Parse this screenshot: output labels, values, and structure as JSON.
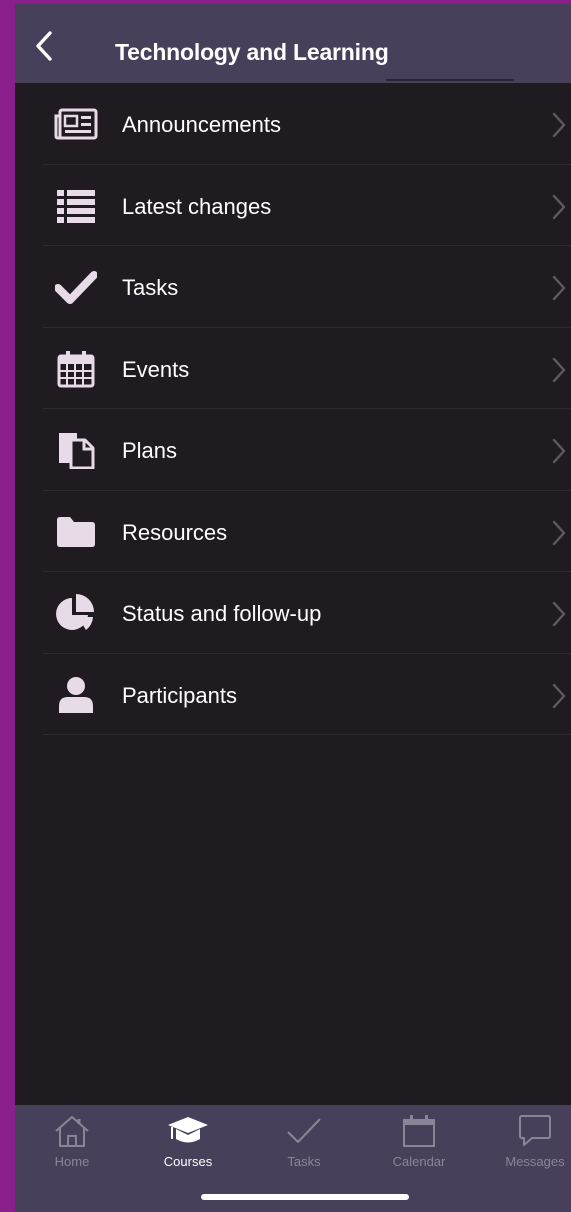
{
  "header": {
    "title": "Technology and Learning",
    "back_icon": "chevron-left-icon"
  },
  "menu": [
    {
      "label": "Announcements",
      "icon": "newspaper-icon"
    },
    {
      "label": "Latest changes",
      "icon": "list-icon"
    },
    {
      "label": "Tasks",
      "icon": "checkmark-icon"
    },
    {
      "label": "Events",
      "icon": "calendar-icon"
    },
    {
      "label": "Plans",
      "icon": "documents-icon"
    },
    {
      "label": "Resources",
      "icon": "folder-icon"
    },
    {
      "label": "Status and follow-up",
      "icon": "pie-chart-icon"
    },
    {
      "label": "Participants",
      "icon": "person-icon"
    }
  ],
  "tabbar": [
    {
      "label": "Home",
      "icon": "home-icon",
      "active": false
    },
    {
      "label": "Courses",
      "icon": "graduation-cap-icon",
      "active": true
    },
    {
      "label": "Tasks",
      "icon": "checkmark-icon",
      "active": false
    },
    {
      "label": "Calendar",
      "icon": "calendar-icon",
      "active": false
    },
    {
      "label": "Messages",
      "icon": "speech-bubble-icon",
      "active": false
    }
  ],
  "colors": {
    "header_bg": "#46405a",
    "content_bg": "#1f1b20",
    "icon": "#e6dbe6",
    "tab_inactive": "#8a8496",
    "tab_active": "#ffffff",
    "frame": "#8a1f8c"
  }
}
